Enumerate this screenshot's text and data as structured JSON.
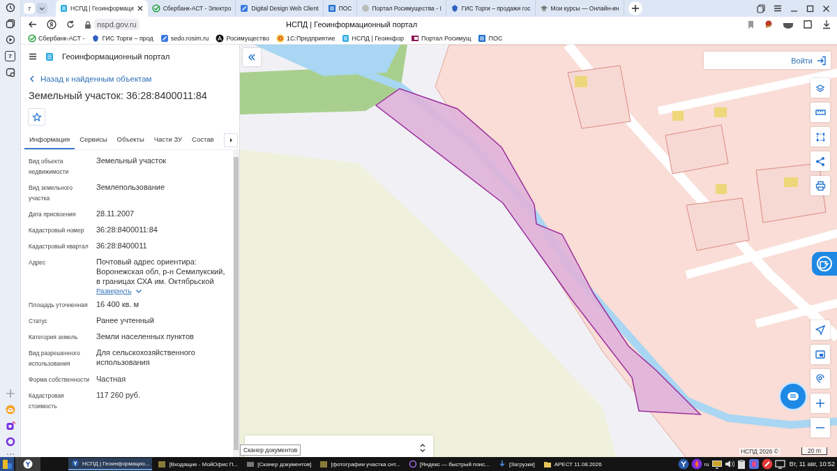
{
  "browser_sidebar": {
    "badge": "7"
  },
  "tab_strip": {
    "tab_count": "7",
    "tabs": [
      {
        "title": "НСПД | Геоинформаци",
        "selected": true
      },
      {
        "title": "Сбербанк-АСТ - Электро",
        "selected": false
      },
      {
        "title": "Digital Design Web Client",
        "selected": false
      },
      {
        "title": "ПОС",
        "selected": false
      },
      {
        "title": "Портал Росимущества - I",
        "selected": false
      },
      {
        "title": "ГИС Торги – продажи гос",
        "selected": false
      },
      {
        "title": "Мои курсы — Онлайн-ин",
        "selected": false
      }
    ]
  },
  "address_bar": {
    "url": "nspd.gov.ru",
    "page_title": "НСПД | Геоинформационный портал"
  },
  "bookmarks": [
    "Сбербанк-АСТ -",
    "ГИС Торги – прод",
    "sedo.rosim.ru",
    "Росимущество",
    "1С:Предприятие",
    "НСПД | Геоинфор",
    "Портал Росимущ",
    "ПОС"
  ],
  "portal": {
    "title": "Геоинформационный портал",
    "back_link": "Назад к найденным объектам",
    "heading": "Земельный участок: 36:28:8400011:84",
    "tabs": [
      {
        "label": "Информация",
        "selected": true
      },
      {
        "label": "Сервисы",
        "selected": false
      },
      {
        "label": "Объекты",
        "selected": false
      },
      {
        "label": "Части ЗУ",
        "selected": false
      },
      {
        "label": "Состав",
        "selected": false
      }
    ],
    "properties": [
      {
        "label": "Вид объекта недвижимости",
        "value": "Земельный участок"
      },
      {
        "label": "Вид земельного участка",
        "value": "Землепользование"
      },
      {
        "label": "Дата присвоения",
        "value": "28.11.2007"
      },
      {
        "label": "Кадастровый номер",
        "value": "36:28:8400011:84"
      },
      {
        "label": "Кадастровый квартал",
        "value": "36:28:8400011"
      },
      {
        "label": "Адрес",
        "value": "Почтовый адрес ориентира: Воронежская обл, р-н Семилукский, в границах СХА им. Октябрьской",
        "expand_link": "Развернуть"
      },
      {
        "label": "Площадь уточненная",
        "value": "16 400 кв. м"
      },
      {
        "label": "Статус",
        "value": "Ранее учтенный"
      },
      {
        "label": "Категория земель",
        "value": "Земли населенных пунктов"
      },
      {
        "label": "Вид разрешенного использования",
        "value": "Для сельскохозяйственного использования"
      },
      {
        "label": "Форма собственности",
        "value": "Частная"
      },
      {
        "label": "Кадастровая стоимость",
        "value": "117 260 руб."
      }
    ]
  },
  "map": {
    "login": "Войти",
    "tooltip": "Сканер документов",
    "attribution": "НСПД 2026 ©",
    "scale": "20 m"
  },
  "taskbar": {
    "windows": [
      {
        "title": "НСПД | Геоинформацио...",
        "selected": true
      },
      {
        "title": "[Входящие - МойОфис П...",
        "selected": false
      },
      {
        "title": "[Сканер документов]",
        "selected": false
      },
      {
        "title": "[фотографии участка снт...",
        "selected": false
      },
      {
        "title": "[Яндекс — быстрый поис...",
        "selected": false
      },
      {
        "title": "[Загрузки]",
        "selected": false
      },
      {
        "title": "АРЕСТ 11.08.2026",
        "selected": false
      }
    ],
    "language": "ru",
    "clock": "Вт, 11 авг, 10:52"
  }
}
